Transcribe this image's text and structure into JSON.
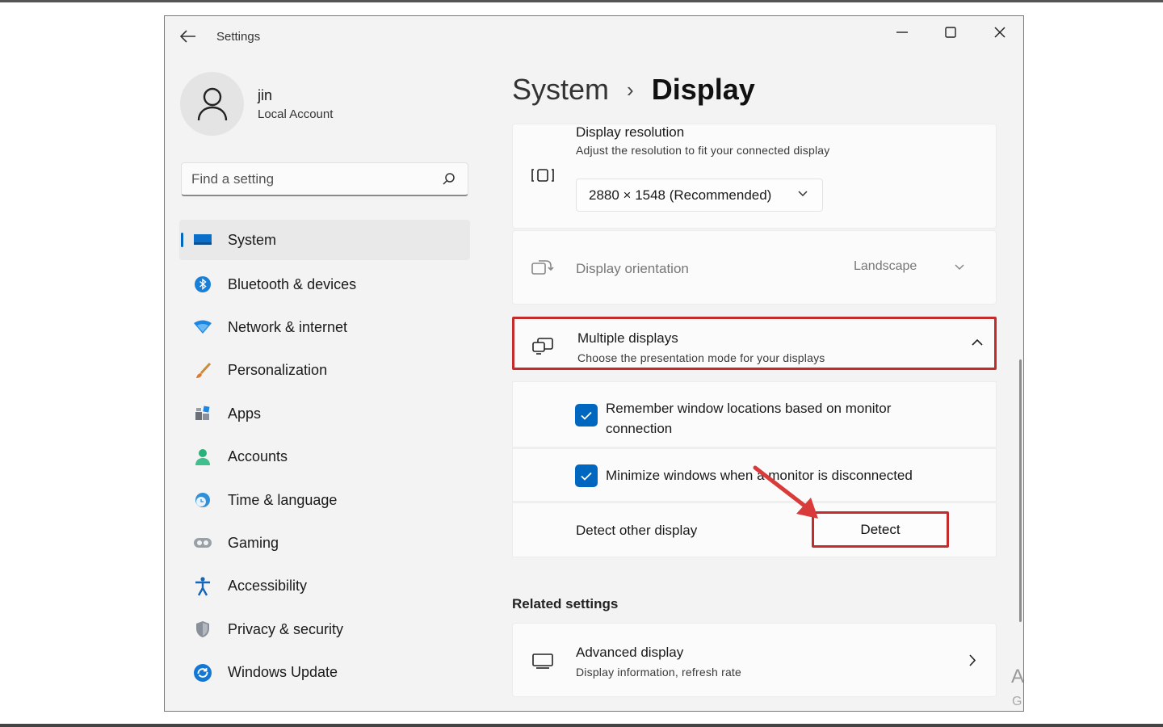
{
  "window": {
    "app_title": "Settings",
    "controls": {
      "minimize": "minimize-icon",
      "maximize": "maximize-icon",
      "close": "close-icon"
    }
  },
  "user": {
    "name": "jin",
    "account_type": "Local Account"
  },
  "search": {
    "placeholder": "Find a setting"
  },
  "sidebar": {
    "items": [
      {
        "label": "System",
        "icon": "system-display-icon",
        "active": true
      },
      {
        "label": "Bluetooth & devices",
        "icon": "bluetooth-icon"
      },
      {
        "label": "Network & internet",
        "icon": "wifi-icon"
      },
      {
        "label": "Personalization",
        "icon": "paintbrush-icon"
      },
      {
        "label": "Apps",
        "icon": "apps-icon"
      },
      {
        "label": "Accounts",
        "icon": "person-icon"
      },
      {
        "label": "Time & language",
        "icon": "globe-clock-icon"
      },
      {
        "label": "Gaming",
        "icon": "gamepad-icon"
      },
      {
        "label": "Accessibility",
        "icon": "accessibility-icon"
      },
      {
        "label": "Privacy & security",
        "icon": "shield-icon"
      },
      {
        "label": "Windows Update",
        "icon": "update-icon"
      }
    ]
  },
  "breadcrumb": {
    "parent": "System",
    "separator": "›",
    "current": "Display"
  },
  "display_resolution": {
    "title": "Display resolution",
    "subtitle": "Adjust the resolution to fit your connected display",
    "selected": "2880 × 1548 (Recommended)"
  },
  "display_orientation": {
    "title": "Display orientation",
    "selected": "Landscape",
    "disabled": true
  },
  "multiple_displays": {
    "title": "Multiple displays",
    "subtitle": "Choose the presentation mode for your displays",
    "expanded": true,
    "remember_label": "Remember window locations based on monitor connection",
    "remember_checked": true,
    "minimize_label": "Minimize windows when a monitor is disconnected",
    "minimize_checked": true,
    "detect_label": "Detect other display",
    "detect_button": "Detect"
  },
  "related": {
    "heading": "Related settings",
    "advanced_title": "Advanced display",
    "advanced_subtitle": "Display information, refresh rate"
  },
  "edge_glyphs": {
    "top": "A",
    "bottom": "G"
  },
  "colors": {
    "accent": "#0067c0",
    "highlight": "#c42b2b"
  }
}
